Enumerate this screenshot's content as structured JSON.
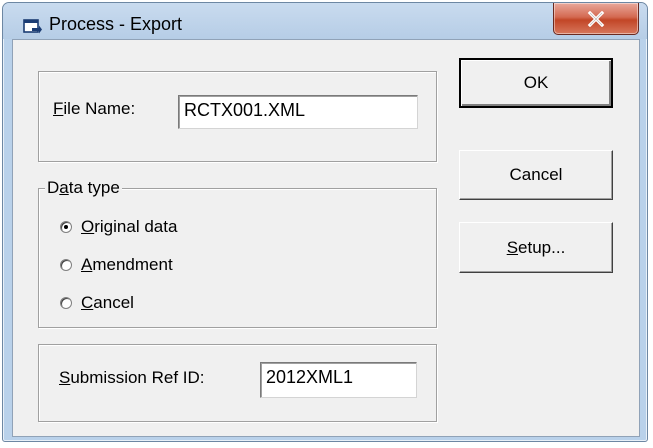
{
  "window": {
    "title": "Process - Export",
    "close_icon": "close-x-icon",
    "app_icon": "export-dialog-icon"
  },
  "file_name": {
    "label_mnemonic": "F",
    "label_rest": "ile Name:",
    "value": "RCTX001.XML"
  },
  "data_type": {
    "legend_pre": "D",
    "legend_mnemonic": "a",
    "legend_post": "ta type",
    "options": [
      {
        "mnemonic": "O",
        "rest": "riginal data",
        "checked": true
      },
      {
        "mnemonic": "A",
        "rest": "mendment",
        "checked": false
      },
      {
        "mnemonic": "C",
        "rest": "ancel",
        "checked": false
      }
    ]
  },
  "submission": {
    "label_mnemonic": "S",
    "label_rest": "ubmission Ref ID:",
    "value": "2012XML1"
  },
  "buttons": {
    "ok": "OK",
    "cancel": "Cancel",
    "setup_mnemonic": "S",
    "setup_rest": "etup..."
  }
}
